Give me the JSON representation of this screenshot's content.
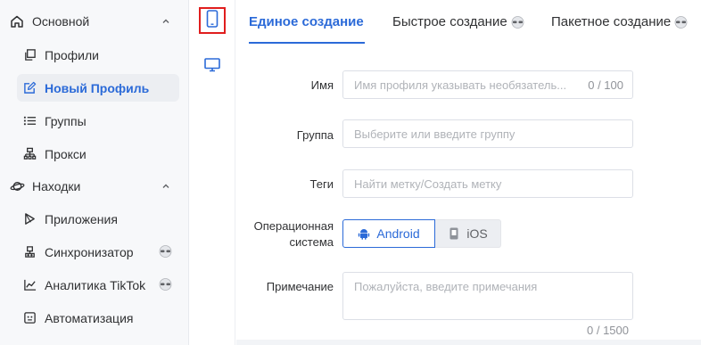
{
  "sidebar": {
    "sections": [
      {
        "label": "Основной",
        "icon": "home-icon"
      },
      {
        "label": "Находки",
        "icon": "planet-icon"
      }
    ],
    "items": [
      {
        "label": "Профили",
        "icon": "copy-icon"
      },
      {
        "label": "Новый Профиль",
        "icon": "edit-icon",
        "active": true
      },
      {
        "label": "Группы",
        "icon": "list-icon"
      },
      {
        "label": "Прокси",
        "icon": "network-icon"
      },
      {
        "label": "Приложения",
        "icon": "play-icon"
      },
      {
        "label": "Синхронизатор",
        "icon": "sync-icon",
        "pro": true
      },
      {
        "label": "Аналитика TikTok",
        "icon": "chart-icon",
        "pro": true
      },
      {
        "label": "Автоматизация",
        "icon": "robot-icon"
      }
    ]
  },
  "rail": {
    "items": [
      {
        "icon": "phone-icon",
        "selected": true
      },
      {
        "icon": "monitor-icon",
        "selected": false
      }
    ]
  },
  "tabs": [
    {
      "label": "Единое создание",
      "active": true
    },
    {
      "label": "Быстрое создание",
      "pro": true
    },
    {
      "label": "Пакетное создание",
      "pro": true
    }
  ],
  "form": {
    "name": {
      "label": "Имя",
      "placeholder": "Имя профиля указывать необязатель...",
      "counter": "0 / 100"
    },
    "group": {
      "label": "Группа",
      "placeholder": "Выберите или введите группу"
    },
    "tags": {
      "label": "Теги",
      "placeholder": "Найти метку/Создать метку"
    },
    "os": {
      "label_line1": "Операционная",
      "label_line2": "система",
      "options": [
        "Android",
        "iOS"
      ],
      "selected": "Android"
    },
    "note": {
      "label": "Примечание",
      "placeholder": "Пожалуйста, введите примечания",
      "counter": "0 / 1500"
    }
  },
  "colors": {
    "accent": "#2b6ad8",
    "highlight_box": "#e01e1e",
    "sidebar_bg": "#f7f8fa"
  }
}
